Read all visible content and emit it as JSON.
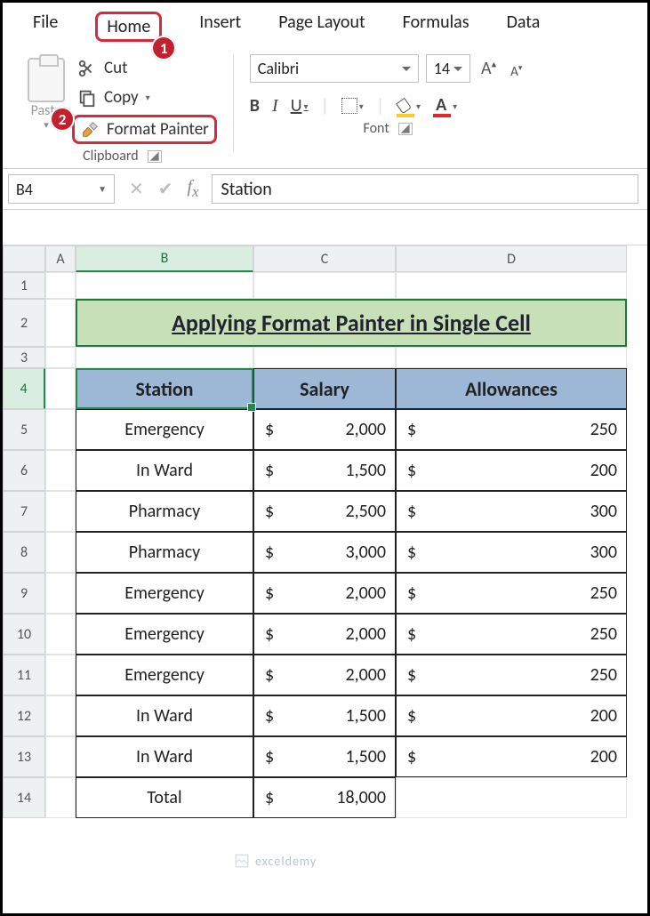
{
  "menu": {
    "file": "File",
    "home": "Home",
    "insert": "Insert",
    "page_layout": "Page Layout",
    "formulas": "Formulas",
    "data": "Data"
  },
  "callout": {
    "n1": "1",
    "n2": "2"
  },
  "ribbon": {
    "paste": "Paste",
    "cut": "Cut",
    "copy": "Copy",
    "format_painter": "Format Painter",
    "clipboard_title": "Clipboard",
    "font_name": "Calibri",
    "font_size": "14",
    "font_title": "Font",
    "bold": "B",
    "italic": "I",
    "underline": "U"
  },
  "namebox": "B4",
  "fx_value": "Station",
  "cols": {
    "A": "A",
    "B": "B",
    "C": "C",
    "D": "D"
  },
  "rows": [
    "1",
    "2",
    "3",
    "4",
    "5",
    "6",
    "7",
    "8",
    "9",
    "10",
    "11",
    "12",
    "13",
    "14"
  ],
  "title": "Applying Format Painter in Single Cell",
  "headers": {
    "station": "Station",
    "salary": "Salary",
    "allow": "Allowances"
  },
  "chart_data": {
    "type": "table",
    "columns": [
      "Station",
      "Salary",
      "Allowances"
    ],
    "rows": [
      {
        "station": "Emergency",
        "salary": 2000,
        "allow": 250
      },
      {
        "station": "In Ward",
        "salary": 1500,
        "allow": 200
      },
      {
        "station": "Pharmacy",
        "salary": 2500,
        "allow": 300
      },
      {
        "station": "Pharmacy",
        "salary": 3000,
        "allow": 300
      },
      {
        "station": "Emergency",
        "salary": 2000,
        "allow": 250
      },
      {
        "station": "Emergency",
        "salary": 2000,
        "allow": 250
      },
      {
        "station": "Emergency",
        "salary": 2000,
        "allow": 250
      },
      {
        "station": "In Ward",
        "salary": 1500,
        "allow": 200
      },
      {
        "station": "In Ward",
        "salary": 1500,
        "allow": 200
      }
    ],
    "total": {
      "label": "Total",
      "salary": 18000
    }
  },
  "display": {
    "rows": [
      {
        "station": "Emergency",
        "salary": "2,000",
        "allow": "250"
      },
      {
        "station": "In Ward",
        "salary": "1,500",
        "allow": "200"
      },
      {
        "station": "Pharmacy",
        "salary": "2,500",
        "allow": "300"
      },
      {
        "station": "Pharmacy",
        "salary": "3,000",
        "allow": "300"
      },
      {
        "station": "Emergency",
        "salary": "2,000",
        "allow": "250"
      },
      {
        "station": "Emergency",
        "salary": "2,000",
        "allow": "250"
      },
      {
        "station": "Emergency",
        "salary": "2,000",
        "allow": "250"
      },
      {
        "station": "In Ward",
        "salary": "1,500",
        "allow": "200"
      },
      {
        "station": "In Ward",
        "salary": "1,500",
        "allow": "200"
      }
    ],
    "total_label": "Total",
    "total_salary": "18,000"
  },
  "currency": "$",
  "watermark": "exceldemy"
}
